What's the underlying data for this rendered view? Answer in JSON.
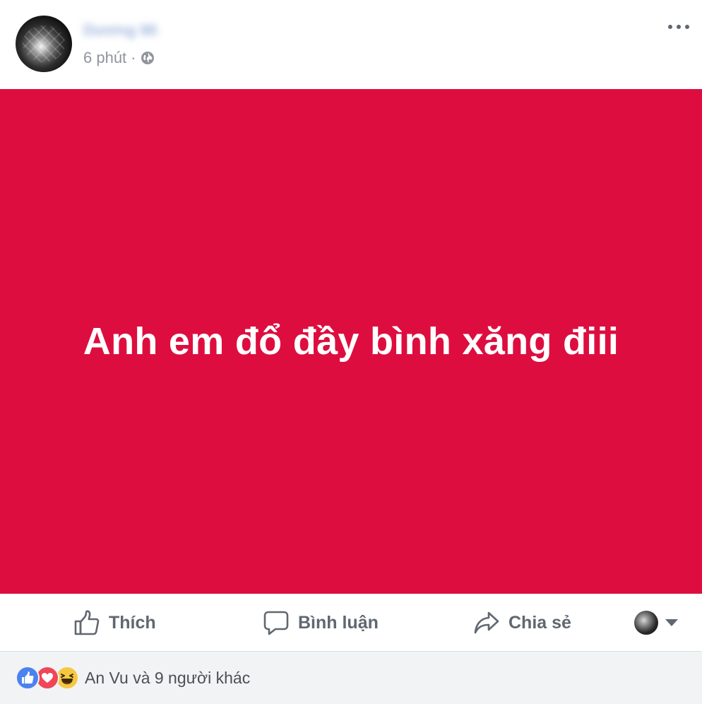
{
  "post": {
    "author_name": "Dương Mi",
    "timestamp": "6 phút",
    "separator": "·",
    "privacy_icon": "globe-icon",
    "body_text": "Anh em đổ đầy bình xăng điii",
    "background_color": "#dd0e3f"
  },
  "actions": {
    "like_label": "Thích",
    "comment_label": "Bình luận",
    "share_label": "Chia sẻ"
  },
  "reactions": {
    "types": [
      "like",
      "love",
      "haha"
    ],
    "summary": "An Vu và 9 người khác"
  },
  "colors": {
    "action_text": "#606770",
    "meta_text": "#90949c",
    "like_blue": "#4a82f0",
    "love_red": "#ef4658",
    "haha_yellow": "#f6c842"
  }
}
